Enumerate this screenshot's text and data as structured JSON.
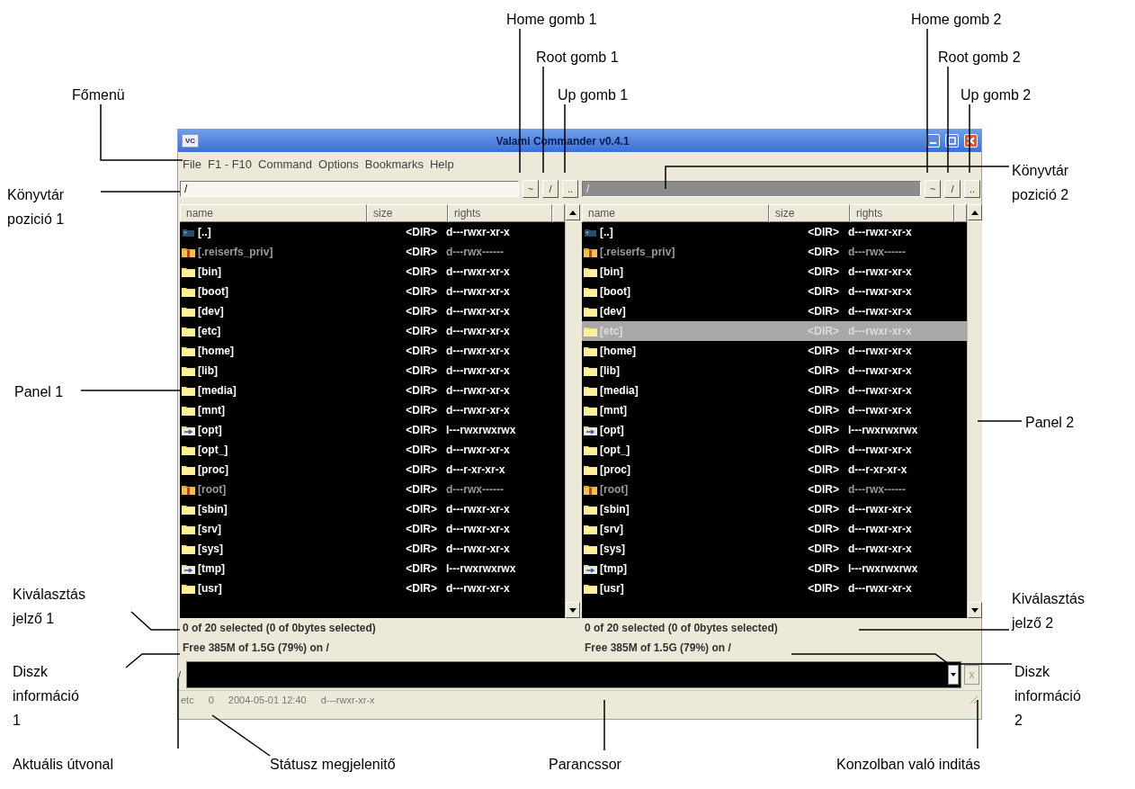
{
  "window": {
    "app_icon": "VC",
    "title": "Valami Commander v0.4.1"
  },
  "menu": [
    "File",
    "F1 - F10",
    "Command",
    "Options",
    "Bookmarks",
    "Help"
  ],
  "panels": [
    {
      "active": true,
      "path": "/",
      "buttons": [
        "~",
        "/",
        ".."
      ],
      "columns": [
        "name",
        "size",
        "rights"
      ],
      "rows": [
        {
          "kind": "up",
          "name": "[..]",
          "size": "<DIR>",
          "rights": "d---rwxr-xr-x",
          "selected": false
        },
        {
          "kind": "locked",
          "name": "[.reiserfs_priv]",
          "size": "<DIR>",
          "rights": "d---rwx------",
          "selected": false
        },
        {
          "kind": "folder",
          "name": "[bin]",
          "size": "<DIR>",
          "rights": "d---rwxr-xr-x",
          "selected": false
        },
        {
          "kind": "folder",
          "name": "[boot]",
          "size": "<DIR>",
          "rights": "d---rwxr-xr-x",
          "selected": false
        },
        {
          "kind": "folder",
          "name": "[dev]",
          "size": "<DIR>",
          "rights": "d---rwxr-xr-x",
          "selected": false
        },
        {
          "kind": "folder",
          "name": "[etc]",
          "size": "<DIR>",
          "rights": "d---rwxr-xr-x",
          "selected": false
        },
        {
          "kind": "folder",
          "name": "[home]",
          "size": "<DIR>",
          "rights": "d---rwxr-xr-x",
          "selected": false
        },
        {
          "kind": "folder",
          "name": "[lib]",
          "size": "<DIR>",
          "rights": "d---rwxr-xr-x",
          "selected": false
        },
        {
          "kind": "folder",
          "name": "[media]",
          "size": "<DIR>",
          "rights": "d---rwxr-xr-x",
          "selected": false
        },
        {
          "kind": "folder",
          "name": "[mnt]",
          "size": "<DIR>",
          "rights": "d---rwxr-xr-x",
          "selected": false
        },
        {
          "kind": "link",
          "name": "[opt]",
          "size": "<DIR>",
          "rights": "l---rwxrwxrwx",
          "selected": false
        },
        {
          "kind": "folder",
          "name": "[opt_]",
          "size": "<DIR>",
          "rights": "d---rwxr-xr-x",
          "selected": false
        },
        {
          "kind": "folder",
          "name": "[proc]",
          "size": "<DIR>",
          "rights": "d---r-xr-xr-x",
          "selected": false
        },
        {
          "kind": "locked",
          "name": "[root]",
          "size": "<DIR>",
          "rights": "d---rwx------",
          "selected": false
        },
        {
          "kind": "folder",
          "name": "[sbin]",
          "size": "<DIR>",
          "rights": "d---rwxr-xr-x",
          "selected": false
        },
        {
          "kind": "folder",
          "name": "[srv]",
          "size": "<DIR>",
          "rights": "d---rwxr-xr-x",
          "selected": false
        },
        {
          "kind": "folder",
          "name": "[sys]",
          "size": "<DIR>",
          "rights": "d---rwxr-xr-x",
          "selected": false
        },
        {
          "kind": "link",
          "name": "[tmp]",
          "size": "<DIR>",
          "rights": "l---rwxrwxrwx",
          "selected": false
        },
        {
          "kind": "folder",
          "name": "[usr]",
          "size": "<DIR>",
          "rights": "d---rwxr-xr-x",
          "selected": false
        }
      ],
      "selection": "0 of 20 selected (0 of 0bytes selected)",
      "disk": "Free 385M of 1.5G (79%) on /"
    },
    {
      "active": false,
      "path": "/",
      "buttons": [
        "~",
        "/",
        ".."
      ],
      "columns": [
        "name",
        "size",
        "rights"
      ],
      "rows": [
        {
          "kind": "up",
          "name": "[..]",
          "size": "<DIR>",
          "rights": "d---rwxr-xr-x",
          "selected": false
        },
        {
          "kind": "locked",
          "name": "[.reiserfs_priv]",
          "size": "<DIR>",
          "rights": "d---rwx------",
          "selected": false
        },
        {
          "kind": "folder",
          "name": "[bin]",
          "size": "<DIR>",
          "rights": "d---rwxr-xr-x",
          "selected": false
        },
        {
          "kind": "folder",
          "name": "[boot]",
          "size": "<DIR>",
          "rights": "d---rwxr-xr-x",
          "selected": false
        },
        {
          "kind": "folder",
          "name": "[dev]",
          "size": "<DIR>",
          "rights": "d---rwxr-xr-x",
          "selected": false
        },
        {
          "kind": "folder",
          "name": "[etc]",
          "size": "<DIR>",
          "rights": "d---rwxr-xr-x",
          "selected": true
        },
        {
          "kind": "folder",
          "name": "[home]",
          "size": "<DIR>",
          "rights": "d---rwxr-xr-x",
          "selected": false
        },
        {
          "kind": "folder",
          "name": "[lib]",
          "size": "<DIR>",
          "rights": "d---rwxr-xr-x",
          "selected": false
        },
        {
          "kind": "folder",
          "name": "[media]",
          "size": "<DIR>",
          "rights": "d---rwxr-xr-x",
          "selected": false
        },
        {
          "kind": "folder",
          "name": "[mnt]",
          "size": "<DIR>",
          "rights": "d---rwxr-xr-x",
          "selected": false
        },
        {
          "kind": "link",
          "name": "[opt]",
          "size": "<DIR>",
          "rights": "l---rwxrwxrwx",
          "selected": false
        },
        {
          "kind": "folder",
          "name": "[opt_]",
          "size": "<DIR>",
          "rights": "d---rwxr-xr-x",
          "selected": false
        },
        {
          "kind": "folder",
          "name": "[proc]",
          "size": "<DIR>",
          "rights": "d---r-xr-xr-x",
          "selected": false
        },
        {
          "kind": "locked",
          "name": "[root]",
          "size": "<DIR>",
          "rights": "d---rwx------",
          "selected": false
        },
        {
          "kind": "folder",
          "name": "[sbin]",
          "size": "<DIR>",
          "rights": "d---rwxr-xr-x",
          "selected": false
        },
        {
          "kind": "folder",
          "name": "[srv]",
          "size": "<DIR>",
          "rights": "d---rwxr-xr-x",
          "selected": false
        },
        {
          "kind": "folder",
          "name": "[sys]",
          "size": "<DIR>",
          "rights": "d---rwxr-xr-x",
          "selected": false
        },
        {
          "kind": "link",
          "name": "[tmp]",
          "size": "<DIR>",
          "rights": "l---rwxrwxrwx",
          "selected": false
        },
        {
          "kind": "folder",
          "name": "[usr]",
          "size": "<DIR>",
          "rights": "d---rwxr-xr-x",
          "selected": false
        }
      ],
      "selection": "0 of 20 selected (0 of 0bytes selected)",
      "disk": "Free 385M of 1.5G (79%) on /"
    }
  ],
  "command_line": {
    "prompt": "/",
    "console_button": "x"
  },
  "status_bar": [
    "etc",
    "0",
    "2004-05-01 12:40",
    "d---rwxr-xr-x"
  ],
  "annotations": [
    {
      "text": "Home gomb 1"
    },
    {
      "text": "Home gomb 2"
    },
    {
      "text": "Root gomb 1"
    },
    {
      "text": "Root gomb 2"
    },
    {
      "text": "Főmenü"
    },
    {
      "text": "Up gomb 1"
    },
    {
      "text": "Up gomb 2"
    },
    {
      "text": "Könyvtár pozició 2"
    },
    {
      "text": "Könyvtár pozició 1"
    },
    {
      "text": "Panel 1"
    },
    {
      "text": "Panel 2"
    },
    {
      "text": "Kiválasztás jelző 1"
    },
    {
      "text": "Kiválasztás jelző 2"
    },
    {
      "text": "Diszk információ 1"
    },
    {
      "text": "Diszk információ 2"
    },
    {
      "text": "Aktuális útvonal"
    },
    {
      "text": "Státusz megjelenitő"
    },
    {
      "text": "Parancssor"
    },
    {
      "text": "Konzolban való inditás"
    }
  ]
}
